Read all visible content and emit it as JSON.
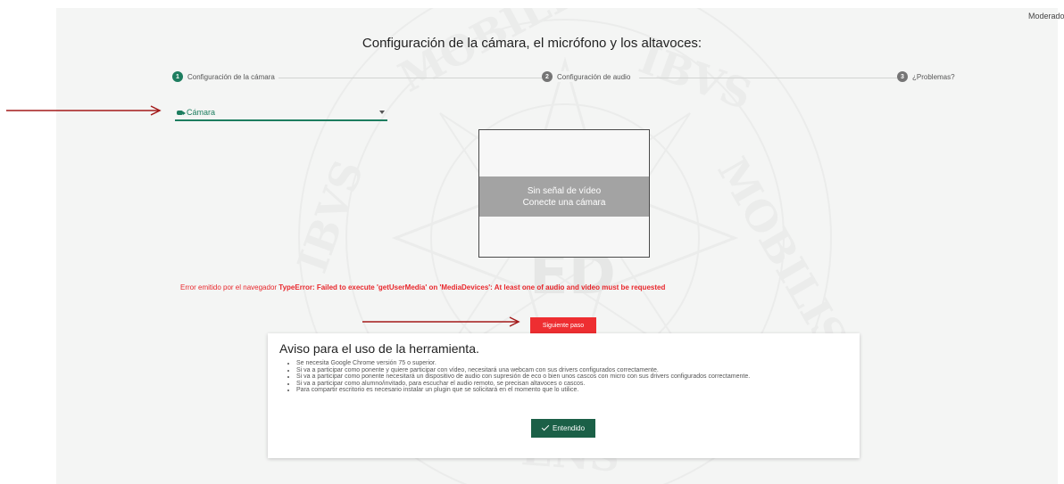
{
  "header": {
    "user_role": "Moderado"
  },
  "page": {
    "title": "Configuración de la cámara, el micrófono y los altavoces:"
  },
  "stepper": {
    "steps": [
      {
        "number": "1",
        "label": "Configuración de la cámara",
        "active": true
      },
      {
        "number": "2",
        "label": "Configuración de audio",
        "active": false
      },
      {
        "number": "3",
        "label": "¿Problemas?",
        "active": false
      }
    ]
  },
  "camera_select": {
    "label": "Cámara",
    "icon": "camera-icon"
  },
  "video_preview": {
    "line1": "Sin señal de vídeo",
    "line2": "Conecte una cámara"
  },
  "error": {
    "prefix": "Error emitido por el navegador",
    "message": "TypeError: Failed to execute 'getUserMedia' on 'MediaDevices': At least one of audio and video must be requested"
  },
  "next_button": {
    "label": "Siguiente paso"
  },
  "notice": {
    "title": "Aviso para el uso de la herramienta.",
    "items": [
      "Se necesita Google Chrome versión 75 o superior.",
      "Si va a participar como ponente y quiere participar con vídeo, necesitará una webcam con sus drivers configurados correctamente.",
      "Si va a participar como ponente necesitará un dispositivo de audio con supresión de eco o bien unos cascos con micro con sus drivers configurados correctamente.",
      "Si va a participar como alumno/invitado, para escuchar el audio remoto, se precisan altavoces o cascos.",
      "Para compartir escritorio es necesario instalar un plugin que se solicitará en el momento que lo utilice."
    ],
    "ok_label": "Entendido"
  },
  "colors": {
    "accent": "#1d7d5f",
    "accent_dark": "#1b6047",
    "error": "#ee2e31",
    "annotation_arrow": "#a31a1a"
  }
}
